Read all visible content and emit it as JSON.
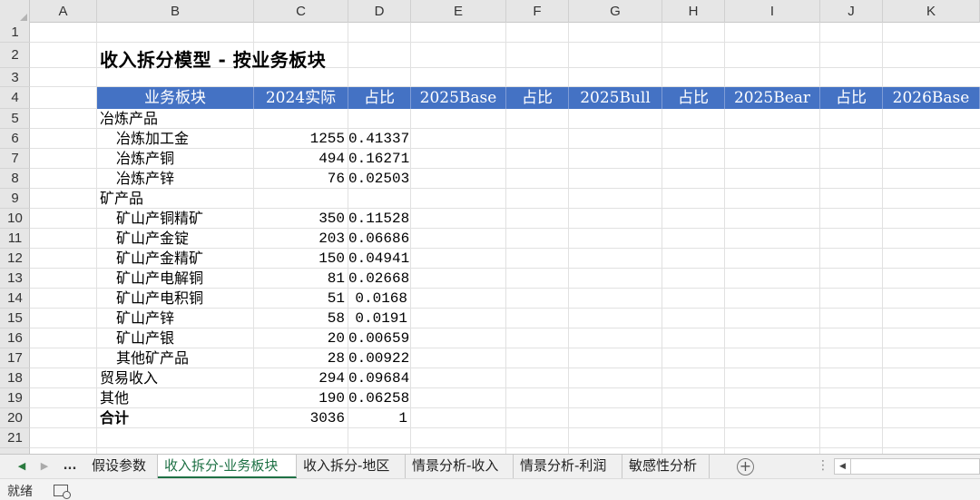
{
  "columns": [
    "A",
    "B",
    "C",
    "D",
    "E",
    "F",
    "G",
    "H",
    "I",
    "J",
    "K"
  ],
  "rows": [
    "1",
    "2",
    "3",
    "4",
    "5",
    "6",
    "7",
    "8",
    "9",
    "10",
    "11",
    "12",
    "13",
    "14",
    "15",
    "16",
    "17",
    "18",
    "19",
    "20",
    "21"
  ],
  "title": "收入拆分模型 - 按业务板块",
  "header": [
    "业务板块",
    "2024实际",
    "占比",
    "2025Base",
    "占比",
    "2025Bull",
    "占比",
    "2025Bear",
    "占比",
    "2026Base"
  ],
  "data_rows": [
    {
      "label": "冶炼产品",
      "indent": false,
      "value": "",
      "share": ""
    },
    {
      "label": "冶炼加工金",
      "indent": true,
      "value": "1255",
      "share": "0.41337"
    },
    {
      "label": "冶炼产铜",
      "indent": true,
      "value": "494",
      "share": "0.16271"
    },
    {
      "label": "冶炼产锌",
      "indent": true,
      "value": "76",
      "share": "0.02503"
    },
    {
      "label": "矿产品",
      "indent": false,
      "value": "",
      "share": ""
    },
    {
      "label": "矿山产铜精矿",
      "indent": true,
      "value": "350",
      "share": "0.11528"
    },
    {
      "label": "矿山产金锭",
      "indent": true,
      "value": "203",
      "share": "0.06686"
    },
    {
      "label": "矿山产金精矿",
      "indent": true,
      "value": "150",
      "share": "0.04941"
    },
    {
      "label": "矿山产电解铜",
      "indent": true,
      "value": "81",
      "share": "0.02668"
    },
    {
      "label": "矿山产电积铜",
      "indent": true,
      "value": "51",
      "share": "0.0168"
    },
    {
      "label": "矿山产锌",
      "indent": true,
      "value": "58",
      "share": "0.0191"
    },
    {
      "label": "矿山产银",
      "indent": true,
      "value": "20",
      "share": "0.00659"
    },
    {
      "label": "其他矿产品",
      "indent": true,
      "value": "28",
      "share": "0.00922"
    },
    {
      "label": "贸易收入",
      "indent": false,
      "value": "294",
      "share": "0.09684"
    },
    {
      "label": "其他",
      "indent": false,
      "value": "190",
      "share": "0.06258"
    },
    {
      "label": "合计",
      "indent": false,
      "bold": true,
      "value": "3036",
      "share": "1"
    }
  ],
  "tabs": {
    "nav_prev": "◀",
    "nav_next": "▶",
    "nav_more": "...",
    "items": [
      "假设参数",
      "收入拆分-业务板块",
      "收入拆分-地区",
      "情景分析-收入",
      "情景分析-利润",
      "敏感性分析"
    ],
    "active_index": 1,
    "add_label": "+",
    "split_dots": "⋮",
    "scroll_arrow": "◀"
  },
  "status": {
    "ready_text": "就绪",
    "macro_icon": "macro-record-icon"
  }
}
